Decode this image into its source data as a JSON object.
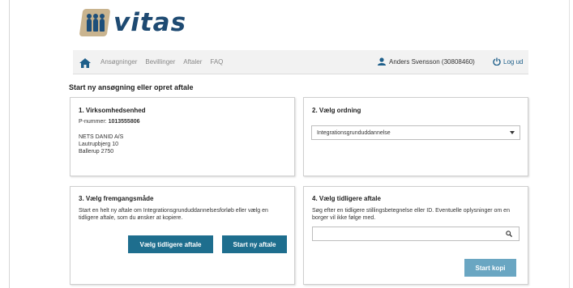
{
  "brand": {
    "name": "vitas"
  },
  "nav": {
    "items": [
      "Ansøgninger",
      "Bevillinger",
      "Aftaler",
      "FAQ"
    ],
    "user": "Anders Svensson (30808460)",
    "logout": "Log ud"
  },
  "page_title": "Start ny ansøgning eller opret aftale",
  "panel1": {
    "title": "1. Virksomhedsenhed",
    "p_label": "P-nummer:",
    "p_value": "1013555806",
    "address": [
      "NETS DANID A/S",
      "Lautrupbjerg 10",
      "Ballerup 2750"
    ]
  },
  "panel2": {
    "title": "2. Vælg ordning",
    "selected": "Integrationsgrunduddannelse"
  },
  "panel3": {
    "title": "3. Vælg fremgangsmåde",
    "text": "Start en helt ny aftale om Integrationsgrunduddannelsesforløb eller vælg en tidligere aftale, som du ønsker at kopiere.",
    "btn_previous": "Vælg tidligere aftale",
    "btn_new": "Start ny aftale"
  },
  "panel4": {
    "title": "4. Vælg tidligere aftale",
    "text": "Søg efter en tidligere stillingsbetegnelse eller ID. Eventuelle oplysninger om en borger vil ikke følge med.",
    "search_value": "",
    "btn_copy": "Start kopi"
  },
  "colors": {
    "primary": "#1e6e8e",
    "primary_light": "#6aa6c2",
    "logo_blue": "#1e4a72",
    "logo_tan": "#c9b48f"
  }
}
